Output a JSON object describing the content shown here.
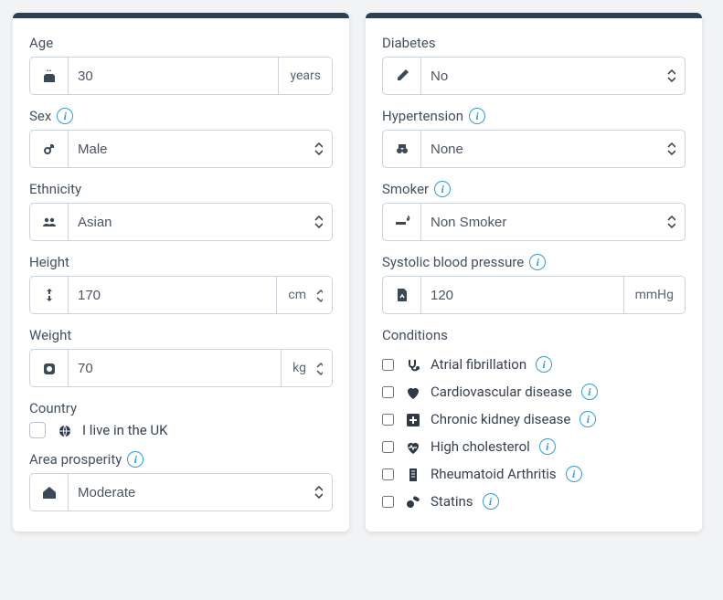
{
  "left": {
    "age": {
      "label": "Age",
      "value": "30",
      "unit": "years"
    },
    "sex": {
      "label": "Sex",
      "value": "Male"
    },
    "ethnicity": {
      "label": "Ethnicity",
      "value": "Asian"
    },
    "height": {
      "label": "Height",
      "value": "170",
      "unit": "cm"
    },
    "weight": {
      "label": "Weight",
      "value": "70",
      "unit": "kg"
    },
    "country": {
      "label": "Country",
      "uk_text": "I live in the UK"
    },
    "area": {
      "label": "Area prosperity",
      "value": "Moderate"
    }
  },
  "right": {
    "diabetes": {
      "label": "Diabetes",
      "value": "No"
    },
    "hypertension": {
      "label": "Hypertension",
      "value": "None"
    },
    "smoker": {
      "label": "Smoker",
      "value": "Non Smoker"
    },
    "sbp": {
      "label": "Systolic blood pressure",
      "value": "120",
      "unit": "mmHg"
    },
    "conditions": {
      "label": "Conditions",
      "items": [
        {
          "label": "Atrial fibrillation",
          "info": true
        },
        {
          "label": "Cardiovascular disease",
          "info": true
        },
        {
          "label": "Chronic kidney disease",
          "info": true
        },
        {
          "label": "High cholesterol",
          "info": true
        },
        {
          "label": "Rheumatoid Arthritis",
          "info": true
        },
        {
          "label": "Statins",
          "info": true
        }
      ]
    }
  }
}
